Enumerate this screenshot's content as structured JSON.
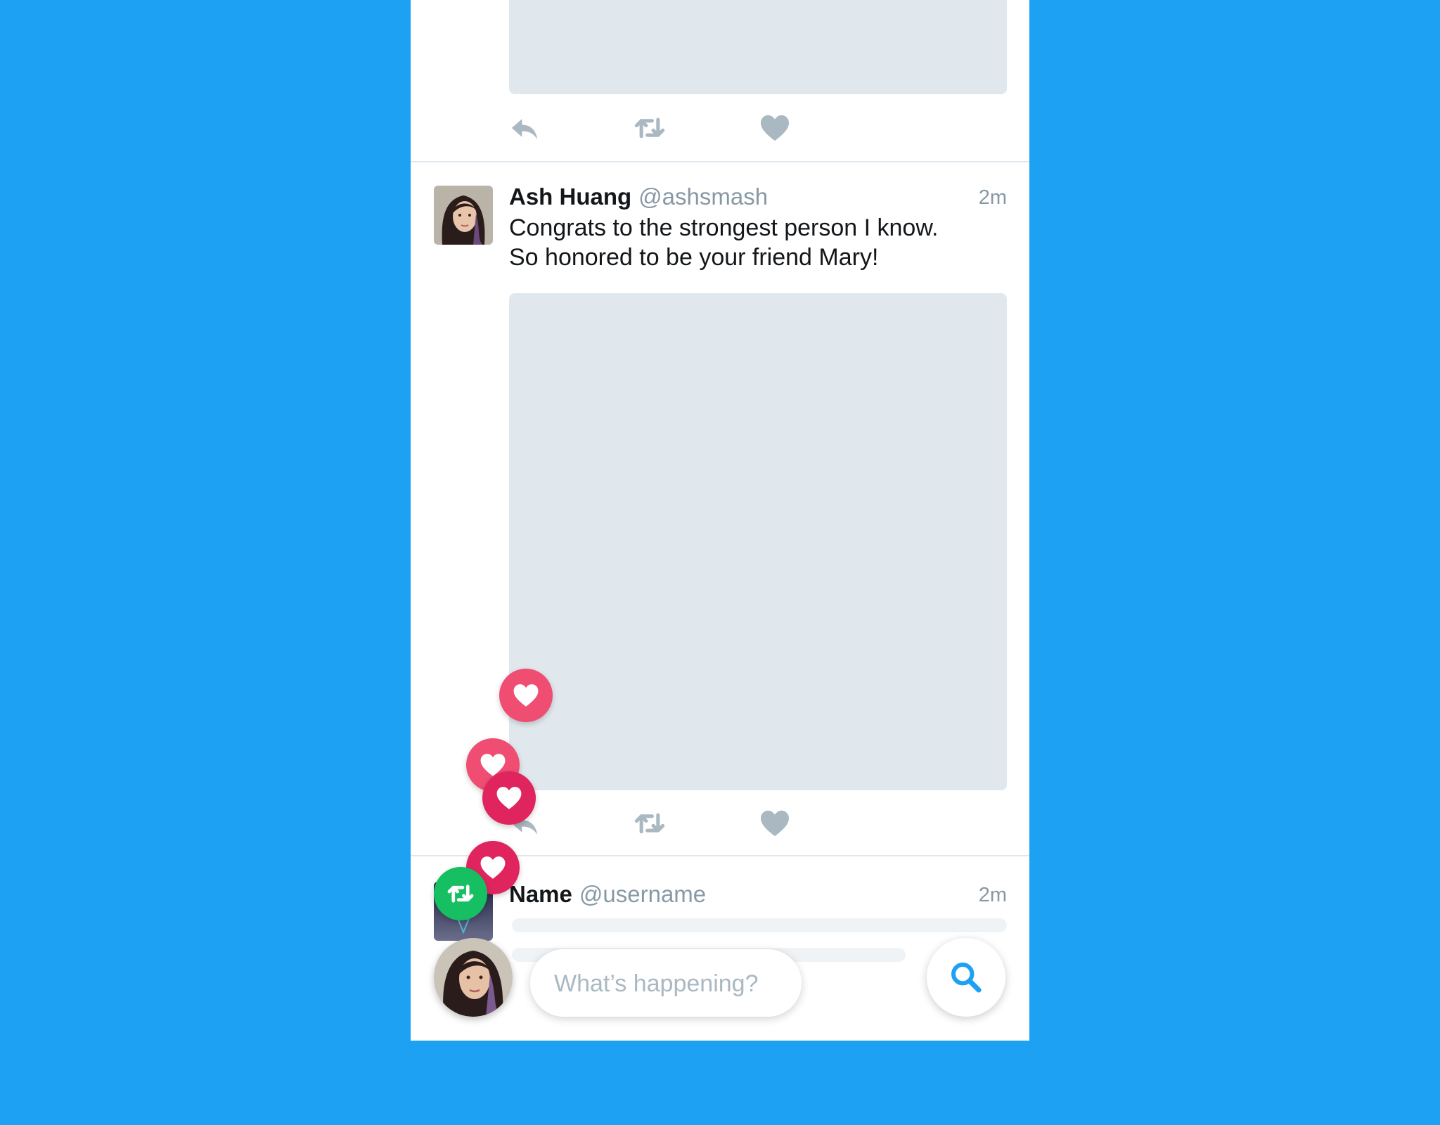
{
  "colors": {
    "brand": "#1da1f2",
    "heart_light": "#ef4d72",
    "heart_dark": "#e0245e",
    "retweet": "#17bf63",
    "icon_gray": "#aab8c2",
    "media_placeholder": "#e1e8ed"
  },
  "tweets": [
    {
      "actions": [
        "reply-icon",
        "retweet-icon",
        "like-icon"
      ]
    },
    {
      "name": "Ash Huang",
      "handle": "@ashsmash",
      "time": "2m",
      "text_line1": "Congrats to the strongest person I know.",
      "text_line2": "So honored to be your friend Mary!",
      "actions": [
        "reply-icon",
        "retweet-icon",
        "like-icon"
      ]
    },
    {
      "name": "Name",
      "handle": "@username",
      "time": "2m"
    }
  ],
  "reaction_bubbles": [
    "heart-icon",
    "heart-icon",
    "heart-icon",
    "heart-icon",
    "retweet-icon"
  ],
  "compose": {
    "placeholder": "What’s happening?"
  },
  "search": {
    "icon": "search-icon"
  }
}
